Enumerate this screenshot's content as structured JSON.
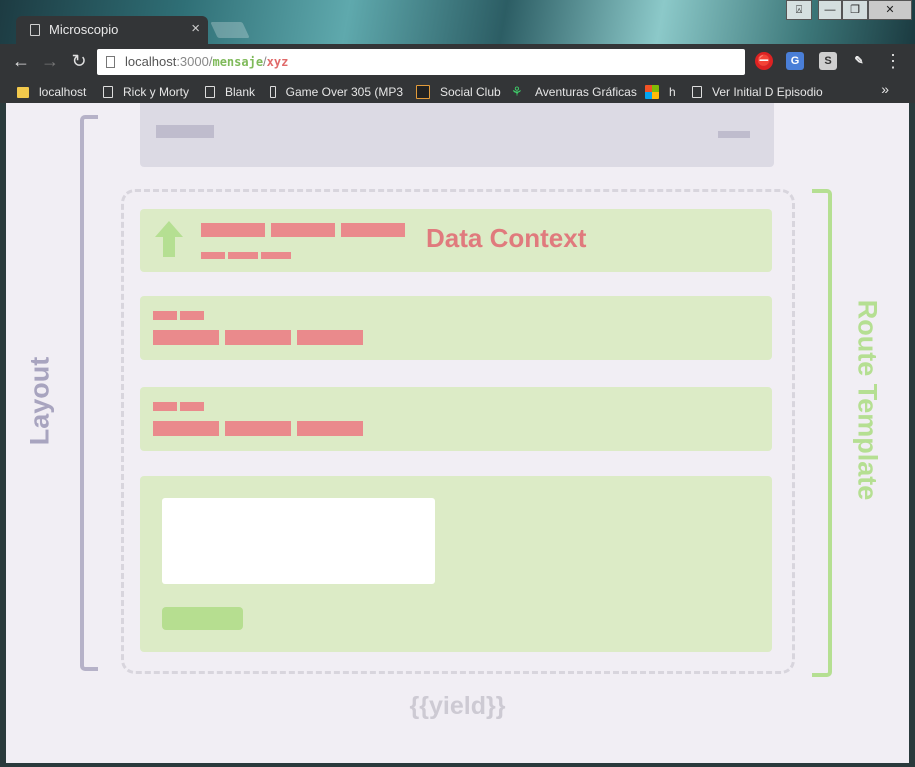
{
  "window": {
    "tab_title": "Microscopio",
    "tab_close": "×",
    "controls": {
      "minimize": "—",
      "restore": "❐",
      "close": "✕"
    },
    "profile_icon": "⍓"
  },
  "toolbar": {
    "back": "←",
    "forward": "→",
    "reload": "↻",
    "url_host": "localhost",
    "url_port": ":3000/",
    "url_path1": "mensaje",
    "url_slash": "/",
    "url_path2": "xyz",
    "menu": "⋮",
    "extensions": [
      "block-icon",
      "translate-icon",
      "s-icon",
      "pen-icon"
    ]
  },
  "bookmarks": {
    "items": [
      {
        "label": "localhost",
        "icon": "folder-icon"
      },
      {
        "label": "Rick y Morty",
        "icon": "page-icon"
      },
      {
        "label": "Blank",
        "icon": "page-icon"
      },
      {
        "label": "Game Over 305 (MP3",
        "icon": "page-icon"
      },
      {
        "label": "Social Club",
        "icon": "social-club-icon"
      },
      {
        "label": "Aventuras Gráficas",
        "icon": "tree-icon"
      },
      {
        "label": "h",
        "icon": "microsoft-icon"
      },
      {
        "label": "Ver Initial D Episodio",
        "icon": "page-icon"
      }
    ],
    "more": "»"
  },
  "diagram": {
    "layout_label": "Layout",
    "route_template_label": "Route Template",
    "data_context_label": "Data Context",
    "yield_label": "{{yield}}",
    "colors": {
      "layout": "#a8a4bf",
      "route": "#b5df92",
      "data_bars": "#ea8a8c",
      "green_box": "#dcebc6"
    }
  }
}
